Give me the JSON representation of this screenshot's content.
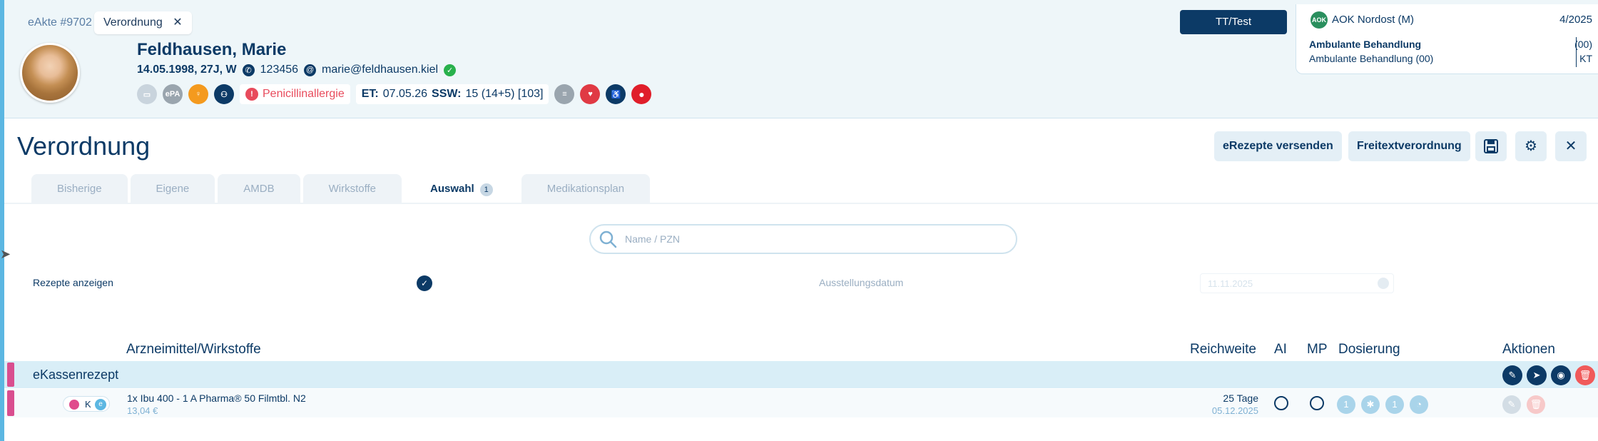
{
  "tabs_top": {
    "akte": "eAkte #9702",
    "verordnung": "Verordnung",
    "close_icon": "close-icon"
  },
  "patient": {
    "name": "Feldhausen,  Marie",
    "dob_age_sex": "14.05.1998, 27J, W",
    "phone": "123456",
    "email": "marie@feldhausen.kiel",
    "badge_epa": "ePA",
    "allergy": "Penicillinallergie",
    "et_label": "ET:",
    "et_value": "07.05.26",
    "ssw_label": "SSW:",
    "ssw_value": "15 (14+5) [103]"
  },
  "tt_button": "TT/Test",
  "insurance": {
    "name": "AOK Nordost (M)",
    "quarter": "4/2025",
    "type_bold": "Ambulante Behandlung",
    "type": "Ambulante Behandlung (00)",
    "code1": "(00)",
    "code2": "KT"
  },
  "page": {
    "title": "Verordnung",
    "btn_erezepte": "eRezepte versenden",
    "btn_freitext": "Freitextverordnung"
  },
  "main_tabs": [
    {
      "label": "Bisherige"
    },
    {
      "label": "Eigene"
    },
    {
      "label": "AMDB"
    },
    {
      "label": "Wirkstoffe"
    },
    {
      "label": "Auswahl",
      "badge": "1"
    },
    {
      "label": "Medikationsplan"
    }
  ],
  "search": {
    "placeholder": "Name / PZN"
  },
  "filters": {
    "rezepte_label": "Rezepte anzeigen",
    "date_label": "Ausstellungsdatum",
    "date_value": "11.11.2025"
  },
  "table": {
    "headers": {
      "med": "Arzneimittel/Wirkstoffe",
      "reach": "Reichweite",
      "ai": "AI",
      "mp": "MP",
      "dose": "Dosierung",
      "actions": "Aktionen"
    },
    "group": "eKassenrezept",
    "rows": [
      {
        "tag": "K",
        "name": "1x Ibu 400 - 1 A Pharma® 50 Filmtbl. N2",
        "price": "13,04 €",
        "reach_days": "25 Tage",
        "reach_date": "05.12.2025",
        "dose": [
          "1",
          "",
          "1",
          ""
        ]
      }
    ]
  },
  "colors": {
    "primary": "#0c3a66",
    "accent": "#5cb7e2",
    "danger": "#f05a5a",
    "group_bar": "#d94e8f"
  }
}
